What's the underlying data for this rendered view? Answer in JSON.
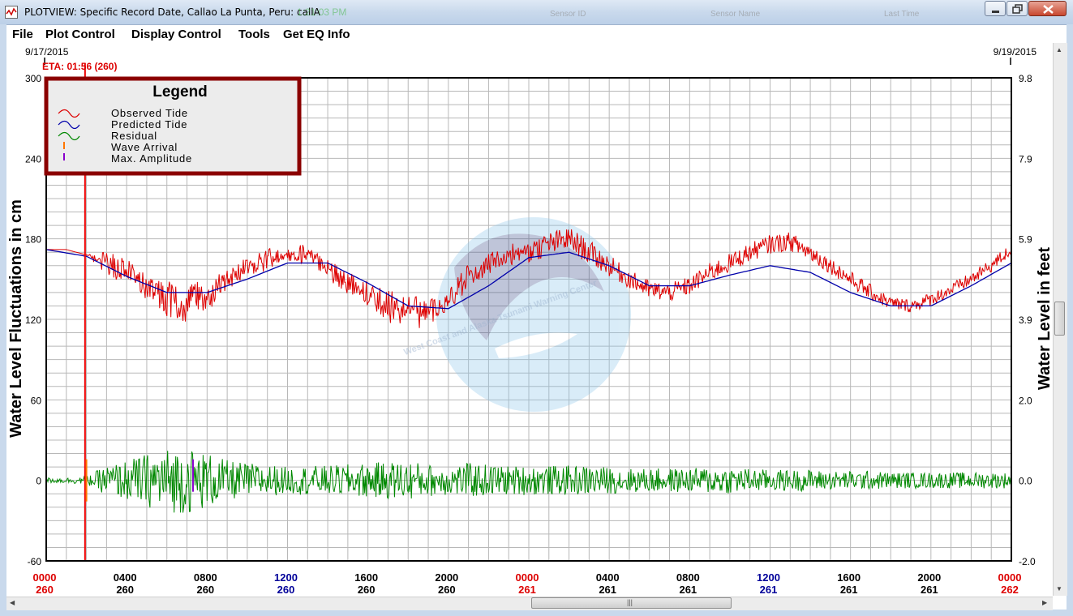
{
  "window": {
    "title": "PLOTVIEW: Specific Record Date, Callao La Punta, Peru: callA",
    "title_extra": "1:21:03 PM",
    "ghost_columns": [
      "Sensor ID",
      "Sensor Name",
      "Last Time"
    ]
  },
  "menu": [
    "File",
    "Plot Control",
    "Display Control",
    "Tools",
    "Get EQ Info"
  ],
  "header": {
    "start_date": "9/17/2015",
    "end_date": "9/19/2015",
    "eta_label": "ETA: 01:56 (260)"
  },
  "colors": {
    "observed": "#dd0000",
    "predicted": "#0000aa",
    "residual": "#008800",
    "wave_arrival": "#ff7700",
    "max_amplitude": "#8800cc",
    "eta_line": "#ee0000",
    "legend_border": "#8b0000",
    "midnight_label": "#dd0000",
    "noon_label": "#000099"
  },
  "legend": {
    "title": "Legend",
    "items": [
      {
        "label": "Observed Tide",
        "icon": "wave-icon",
        "color": "#dd0000"
      },
      {
        "label": "Predicted Tide",
        "icon": "wave-icon",
        "color": "#0000aa"
      },
      {
        "label": "Residual",
        "icon": "wave-icon",
        "color": "#008800"
      },
      {
        "label": "Wave Arrival",
        "icon": "tick-icon",
        "color": "#ff7700"
      },
      {
        "label": "Max. Amplitude",
        "icon": "tick-icon",
        "color": "#8800cc"
      }
    ]
  },
  "watermark": {
    "text": "West Coast and Alaska Tsunami Warning Center",
    "icon": "noaa-logo-icon"
  },
  "chart_data": {
    "type": "line",
    "ylabel": "Water Level Fluctuations in cm",
    "y2label": "Water Level in feet",
    "ylim": [
      -60,
      300
    ],
    "yticks": [
      "300",
      "240",
      "180",
      "120",
      "60",
      "0",
      "-60"
    ],
    "y2ticks": [
      "9.8",
      "7.9",
      "5.9",
      "3.9",
      "2.0",
      "0.0",
      "-2.0"
    ],
    "xlim_hours": [
      0,
      48
    ],
    "xticks": [
      {
        "time": "0000",
        "day": "260",
        "style": "midnight"
      },
      {
        "time": "0400",
        "day": "260",
        "style": "normal"
      },
      {
        "time": "0800",
        "day": "260",
        "style": "normal"
      },
      {
        "time": "1200",
        "day": "260",
        "style": "noon"
      },
      {
        "time": "1600",
        "day": "260",
        "style": "normal"
      },
      {
        "time": "2000",
        "day": "260",
        "style": "normal"
      },
      {
        "time": "0000",
        "day": "261",
        "style": "midnight"
      },
      {
        "time": "0400",
        "day": "261",
        "style": "normal"
      },
      {
        "time": "0800",
        "day": "261",
        "style": "normal"
      },
      {
        "time": "1200",
        "day": "261",
        "style": "noon"
      },
      {
        "time": "1600",
        "day": "261",
        "style": "normal"
      },
      {
        "time": "2000",
        "day": "261",
        "style": "normal"
      },
      {
        "time": "0000",
        "day": "262",
        "style": "midnight"
      }
    ],
    "grid": true,
    "eta_hour": 1.93,
    "wave_arrival": {
      "hour": 2.0,
      "value": 0
    },
    "max_amplitude": {
      "hour": 7.3,
      "value": 0
    },
    "series": [
      {
        "name": "Predicted Tide",
        "x": [
          0,
          2,
          4,
          6,
          8,
          10,
          12,
          14,
          16,
          18,
          20,
          22,
          24,
          26,
          28,
          30,
          32,
          34,
          36,
          38,
          40,
          42,
          44,
          46,
          48
        ],
        "values": [
          172,
          167,
          152,
          140,
          140,
          150,
          162,
          162,
          147,
          130,
          128,
          145,
          166,
          170,
          160,
          145,
          145,
          153,
          160,
          155,
          140,
          130,
          130,
          145,
          162
        ]
      },
      {
        "name": "Observed Tide",
        "x": [
          0,
          1,
          2,
          3,
          4,
          5,
          6,
          7,
          8,
          9,
          10,
          11,
          12,
          13,
          14,
          15,
          16,
          17,
          18,
          19,
          20,
          21,
          22,
          23,
          24,
          25,
          26,
          27,
          28,
          29,
          30,
          31,
          32,
          33,
          34,
          35,
          36,
          37,
          38,
          39,
          40,
          41,
          42,
          43,
          44,
          45,
          46,
          47,
          48
        ],
        "values": [
          172,
          172,
          168,
          162,
          155,
          145,
          135,
          130,
          138,
          148,
          158,
          165,
          170,
          168,
          158,
          148,
          138,
          130,
          125,
          125,
          135,
          152,
          162,
          168,
          170,
          176,
          180,
          170,
          160,
          150,
          142,
          140,
          145,
          155,
          162,
          170,
          176,
          178,
          170,
          160,
          150,
          140,
          132,
          130,
          135,
          142,
          150,
          160,
          172
        ],
        "noise_cm": [
          0,
          0,
          0,
          18,
          20,
          22,
          28,
          30,
          26,
          18,
          18,
          16,
          14,
          14,
          16,
          18,
          20,
          24,
          26,
          22,
          18,
          18,
          16,
          16,
          16,
          18,
          18,
          18,
          16,
          14,
          14,
          14,
          14,
          14,
          14,
          14,
          14,
          14,
          14,
          12,
          12,
          12,
          10,
          10,
          10,
          10,
          10,
          10,
          10
        ]
      },
      {
        "name": "Residual",
        "x": [
          0,
          1,
          2,
          3,
          4,
          5,
          6,
          7,
          8,
          9,
          10,
          11,
          12,
          13,
          14,
          15,
          16,
          17,
          18,
          19,
          20,
          21,
          22,
          23,
          24,
          25,
          26,
          27,
          28,
          29,
          30,
          31,
          32,
          33,
          34,
          35,
          36,
          37,
          38,
          39,
          40,
          41,
          42,
          43,
          44,
          45,
          46,
          47,
          48
        ],
        "values": [
          0,
          0,
          0,
          0,
          0,
          0,
          0,
          0,
          0,
          0,
          0,
          0,
          0,
          0,
          0,
          0,
          0,
          0,
          0,
          0,
          0,
          0,
          0,
          0,
          0,
          0,
          0,
          0,
          0,
          0,
          0,
          0,
          0,
          0,
          0,
          0,
          0,
          0,
          0,
          0,
          0,
          0,
          0,
          0,
          0,
          0,
          0,
          0,
          0
        ],
        "noise_cm": [
          4,
          4,
          6,
          22,
          30,
          40,
          48,
          50,
          42,
          30,
          26,
          24,
          20,
          22,
          22,
          24,
          26,
          28,
          30,
          24,
          22,
          26,
          24,
          22,
          22,
          22,
          22,
          22,
          20,
          18,
          18,
          18,
          18,
          20,
          20,
          18,
          16,
          16,
          16,
          14,
          14,
          14,
          12,
          12,
          12,
          12,
          12,
          12,
          12
        ]
      }
    ]
  }
}
